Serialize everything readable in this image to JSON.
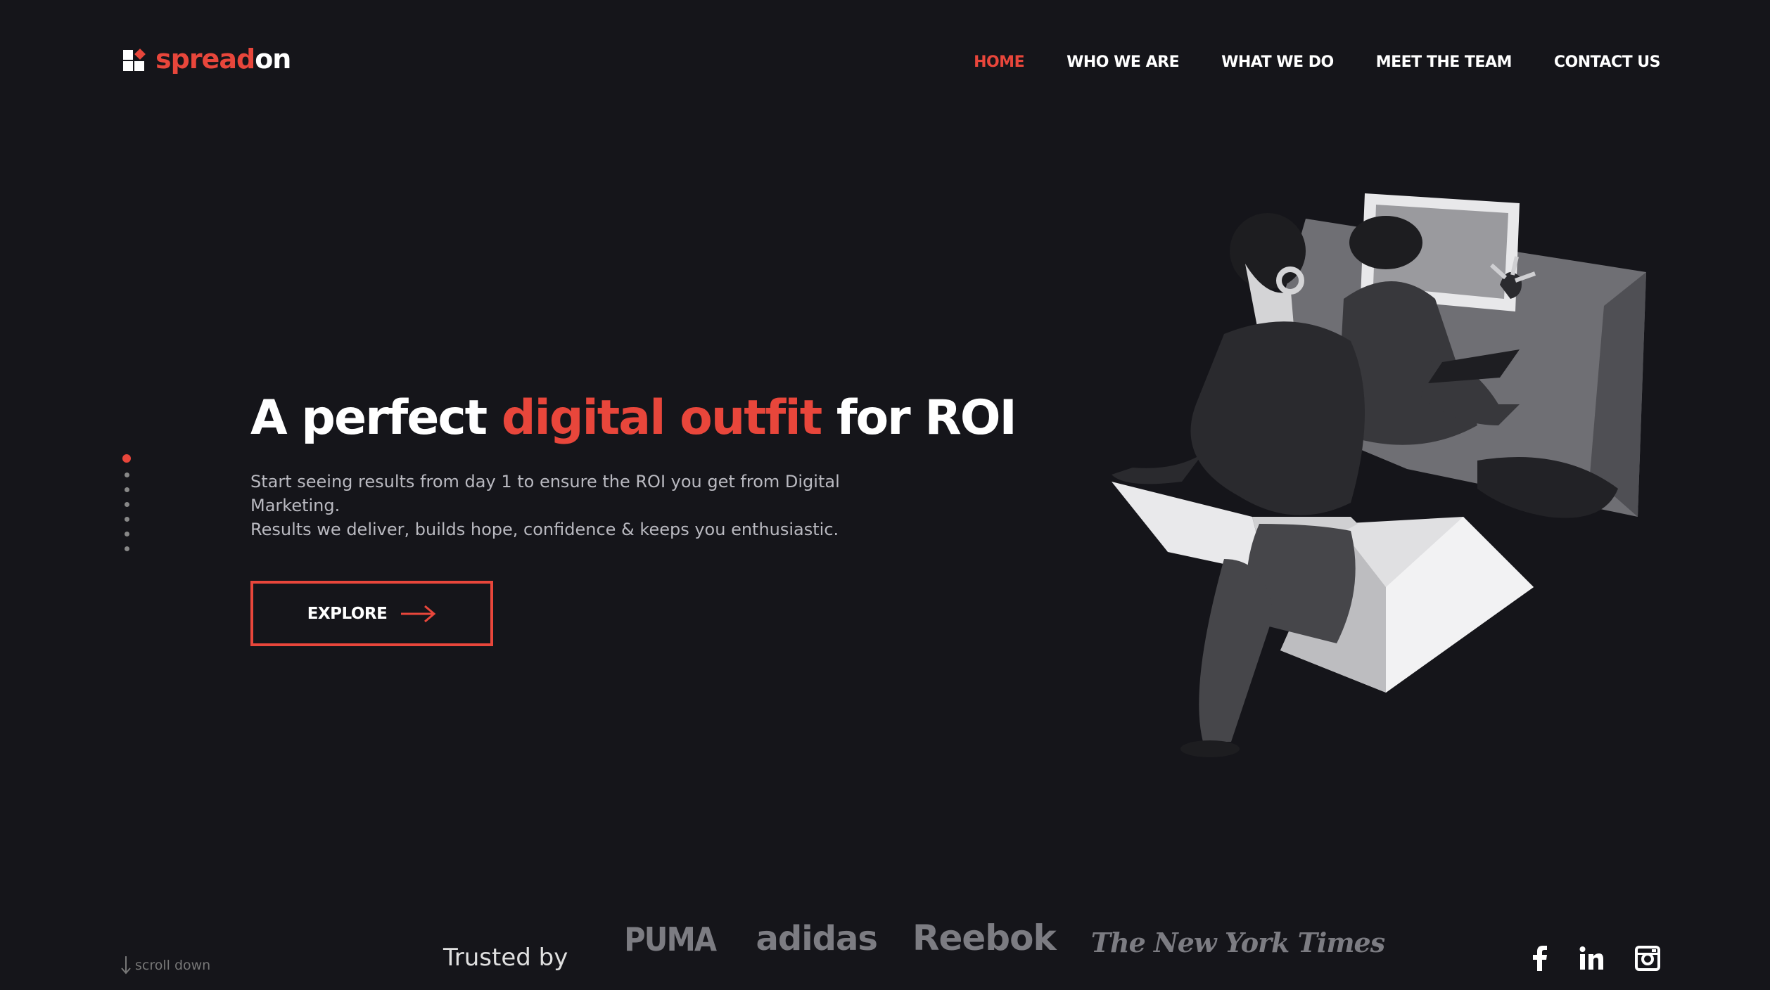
{
  "brand": {
    "name_part1": "spread",
    "name_part2": "on"
  },
  "nav": {
    "items": [
      {
        "label": "HOME",
        "active": true
      },
      {
        "label": "WHO WE ARE",
        "active": false
      },
      {
        "label": "WHAT WE DO",
        "active": false
      },
      {
        "label": "MEET THE TEAM",
        "active": false
      },
      {
        "label": "CONTACT US",
        "active": false
      }
    ]
  },
  "hero": {
    "title_part1": "A perfect ",
    "title_highlight": "digital outfit",
    "title_part2": " for ROI",
    "desc_line1": "Start seeing results from day 1 to ensure the ROI you get from Digital Marketing.",
    "desc_line2": "Results we deliver, builds hope, confidence & keeps you enthusiastic.",
    "cta_label": "EXPLORE"
  },
  "pager": {
    "count": 7,
    "active_index": 0
  },
  "scroll_label": "scroll down",
  "trusted": {
    "label": "Trusted by",
    "brands": [
      "PUMA",
      "adidas",
      "Reebok",
      "The New York Times"
    ]
  },
  "social": {
    "icons": [
      "facebook-icon",
      "linkedin-icon",
      "instagram-icon"
    ]
  },
  "colors": {
    "accent": "#e8463b",
    "background": "#15151a",
    "muted": "#7c7c82"
  }
}
